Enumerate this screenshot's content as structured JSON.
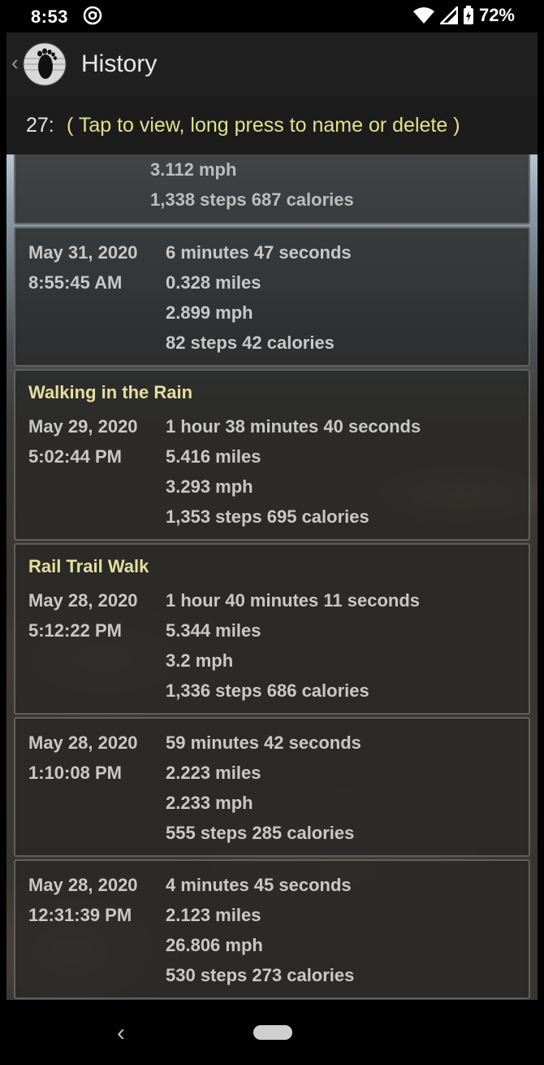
{
  "status": {
    "time": "8:53",
    "battery": "72%"
  },
  "header": {
    "title": "History"
  },
  "hint": {
    "count": "27:",
    "text": "( Tap to view, long press to name or delete )"
  },
  "walks": [
    {
      "name": "",
      "date": "",
      "time": "",
      "duration": "",
      "distance": "",
      "speed": "3.112 mph",
      "steps_calories": "1,338 steps  687 calories"
    },
    {
      "name": "",
      "date": "May 31, 2020",
      "time": "8:55:45 AM",
      "duration": "6 minutes 47 seconds",
      "distance": "0.328 miles",
      "speed": "2.899 mph",
      "steps_calories": "82 steps  42 calories"
    },
    {
      "name": "Walking in the Rain",
      "date": "May 29, 2020",
      "time": "5:02:44 PM",
      "duration": "1 hour 38 minutes 40 seconds",
      "distance": "5.416 miles",
      "speed": "3.293 mph",
      "steps_calories": "1,353 steps  695 calories"
    },
    {
      "name": "Rail Trail Walk",
      "date": "May 28, 2020",
      "time": "5:12:22 PM",
      "duration": "1 hour 40 minutes 11 seconds",
      "distance": "5.344 miles",
      "speed": "3.2 mph",
      "steps_calories": "1,336 steps  686 calories"
    },
    {
      "name": "",
      "date": "May 28, 2020",
      "time": "1:10:08 PM",
      "duration": "59 minutes 42 seconds",
      "distance": "2.223 miles",
      "speed": "2.233 mph",
      "steps_calories": "555 steps  285 calories"
    },
    {
      "name": "",
      "date": "May 28, 2020",
      "time": "12:31:39 PM",
      "duration": "4 minutes 45 seconds",
      "distance": "2.123 miles",
      "speed": "26.806 mph",
      "steps_calories": "530 steps  273 calories"
    }
  ]
}
